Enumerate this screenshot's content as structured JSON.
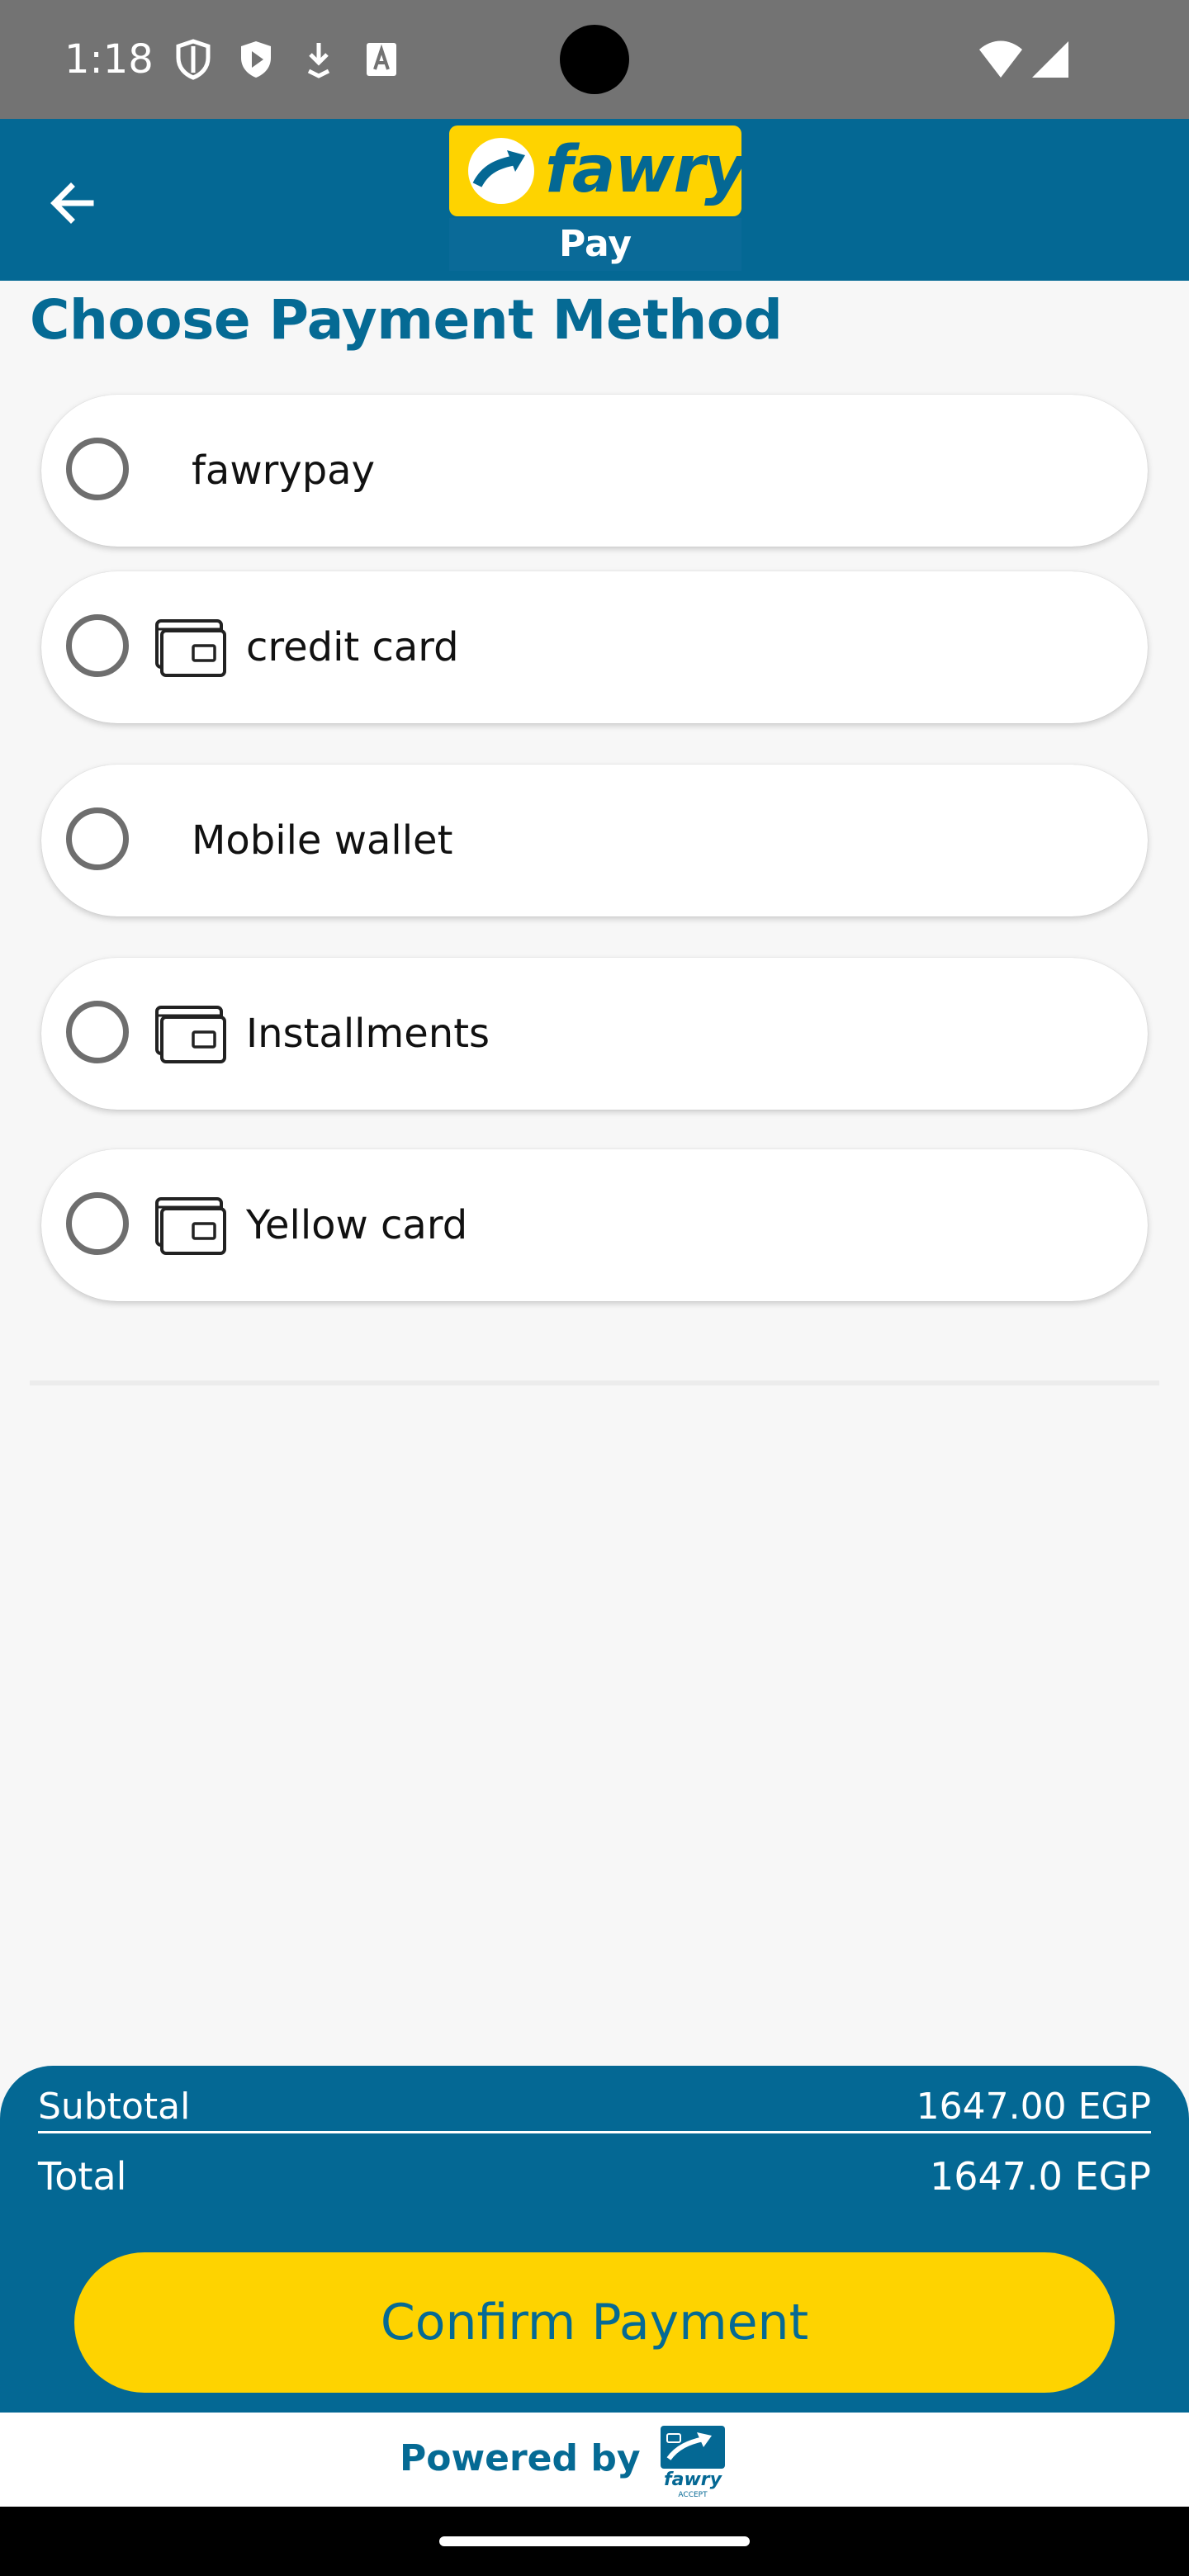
{
  "status_bar": {
    "time": "1:18",
    "icons": [
      "shield-icon",
      "play-icon",
      "download-icon",
      "text-icon",
      "wifi-icon",
      "signal-icon"
    ]
  },
  "header": {
    "back_icon": "arrow-left-icon",
    "logo_text": "fawry",
    "logo_subtext": "Pay"
  },
  "page": {
    "title": "Choose Payment Method"
  },
  "payment_options": [
    {
      "label": "fawrypay",
      "has_icon": false,
      "icon": ""
    },
    {
      "label": "credit card",
      "has_icon": true,
      "icon": "card-icon"
    },
    {
      "label": "Mobile wallet",
      "has_icon": false,
      "icon": ""
    },
    {
      "label": "Installments",
      "has_icon": true,
      "icon": "card-icon"
    },
    {
      "label": "Yellow card",
      "has_icon": true,
      "icon": "card-icon"
    }
  ],
  "summary": {
    "subtotal_label": "Subtotal",
    "subtotal_value": "1647.00 EGP",
    "total_label": "Total",
    "total_value": "1647.0 EGP"
  },
  "actions": {
    "confirm_label": "Confirm Payment"
  },
  "footer": {
    "powered_by": "Powered by",
    "logo_text": "fawry",
    "logo_subtext": "ACCEPT"
  },
  "colors": {
    "brand_blue": "#046894",
    "brand_yellow": "#fed300",
    "status_bar": "#737373"
  }
}
